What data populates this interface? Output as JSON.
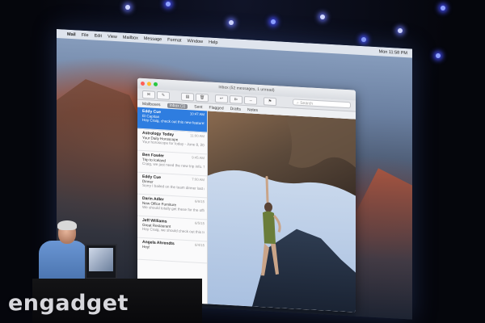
{
  "menubar": {
    "app": "Mail",
    "items": [
      "File",
      "Edit",
      "View",
      "Mailbox",
      "Message",
      "Format",
      "Window",
      "Help"
    ],
    "clock": "Mon 11:58 PM"
  },
  "window": {
    "title": "Inbox (52 messages, 1 unread)",
    "search_placeholder": "Search",
    "favorites": [
      "Mailboxes",
      "Inbox (1)",
      "Sent",
      "Flagged",
      "Drafts",
      "Notes"
    ],
    "selected_favorite_index": 1
  },
  "messages": [
    {
      "from": "Eddy Cue",
      "subject": "El Capitan",
      "time": "10:47 AM",
      "preview": "Hey Craig, check out this new feature! Remember me?",
      "selected": true
    },
    {
      "from": "Astrology Today",
      "subject": "Your Daily Horoscope",
      "time": "11:00 AM",
      "preview": "Your horoscope for today - June 8, 2015. Hello Today is a great day to..."
    },
    {
      "from": "Ben Fowler",
      "subject": "Trip to Iceland",
      "time": "9:45 AM",
      "preview": "Craig, we just need the new trip info. This week we should not be ..."
    },
    {
      "from": "Eddy Cue",
      "subject": "Dinner",
      "time": "7:00 AM",
      "preview": "Sorry I bailed on the team dinner last night. I was swamped with ..."
    },
    {
      "from": "Darin Adler",
      "subject": "New Office Furniture",
      "time": "6/6/15",
      "preview": "We should totally get these for the office. Talk about an improvement."
    },
    {
      "from": "Jeff Williams",
      "subject": "Great Restaurant",
      "time": "6/5/15",
      "preview": "Hey Craig, we should check out this Indian restaurant when we're in ..."
    },
    {
      "from": "Angela Ahrendts",
      "subject": "Hey!",
      "time": "6/4/15",
      "preview": ""
    }
  ],
  "watermark": "engadget",
  "colors": {
    "selected_row": "#2e7de0",
    "spotlight": "#8da0ff",
    "traffic_close": "#ff5f57",
    "traffic_min": "#febc2e",
    "traffic_max": "#28c840"
  }
}
